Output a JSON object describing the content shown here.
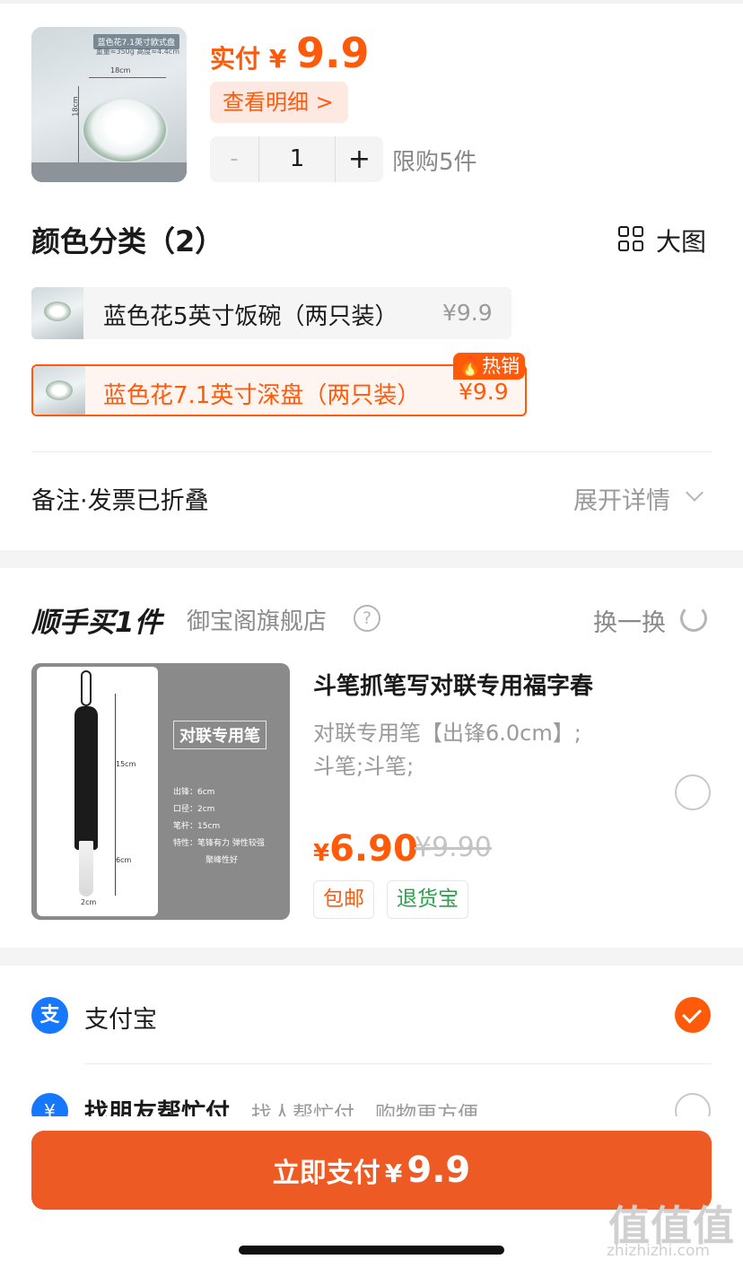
{
  "product": {
    "image_tag": "蓝色花7.1英寸欧式盘",
    "image_sub": "重量≈350g 高度≈4.4cm",
    "image_dim_w": "18cm",
    "image_dim_h": "18cm",
    "pay_label": "实付 ¥",
    "pay_amount": "9.9",
    "detail_label": "查看明细 >",
    "qty_minus": "-",
    "qty_value": "1",
    "qty_plus": "+",
    "limit": "限购5件"
  },
  "color": {
    "title": "颜色分类（2）",
    "big_view": "大图",
    "variants": [
      {
        "name": "蓝色花5英寸饭碗（两只装）",
        "price": "¥9.9"
      },
      {
        "name": "蓝色花7.1英寸深盘（两只装）",
        "price": "¥9.9",
        "badge": "热销"
      }
    ]
  },
  "remark": {
    "label": "备注·发票已折叠",
    "expand": "展开详情"
  },
  "addon": {
    "title": "顺手买1件",
    "store": "御宝阁旗舰店",
    "help": "?",
    "swap": "换一换",
    "card": {
      "label": "对联专用笔",
      "m1": "15cm",
      "m2": "6cm",
      "m3": "2cm",
      "specs": [
        "出锋：6cm",
        "口径：2cm",
        "笔杆：15cm",
        "特性：笔锋有力 弹性较强",
        "聚峰性好"
      ]
    },
    "name": "斗笔抓笔写对联专用福字春",
    "desc1": "对联专用笔【出锋6.0cm】;",
    "desc2": "斗笔;斗笔;",
    "currency": "¥",
    "price": "6.90",
    "old_price": "¥9.90",
    "badges": [
      "包邮",
      "退货宝"
    ]
  },
  "payment": {
    "alipay": "支付宝",
    "alipay_icon": "支",
    "friend": "找朋友帮忙付",
    "friend_icon": "¥",
    "friend_desc": "找人帮忙付，购物更方便"
  },
  "pay_button": {
    "label": "立即支付",
    "currency": "¥",
    "amount": "9.9"
  },
  "watermark": {
    "text": "值值值",
    "domain": "zhizhizhi.com"
  },
  "colors": {
    "accent": "#ff5a0a",
    "button": "#ee5a23",
    "alipay": "#1677ff",
    "green": "#2ba14c"
  }
}
